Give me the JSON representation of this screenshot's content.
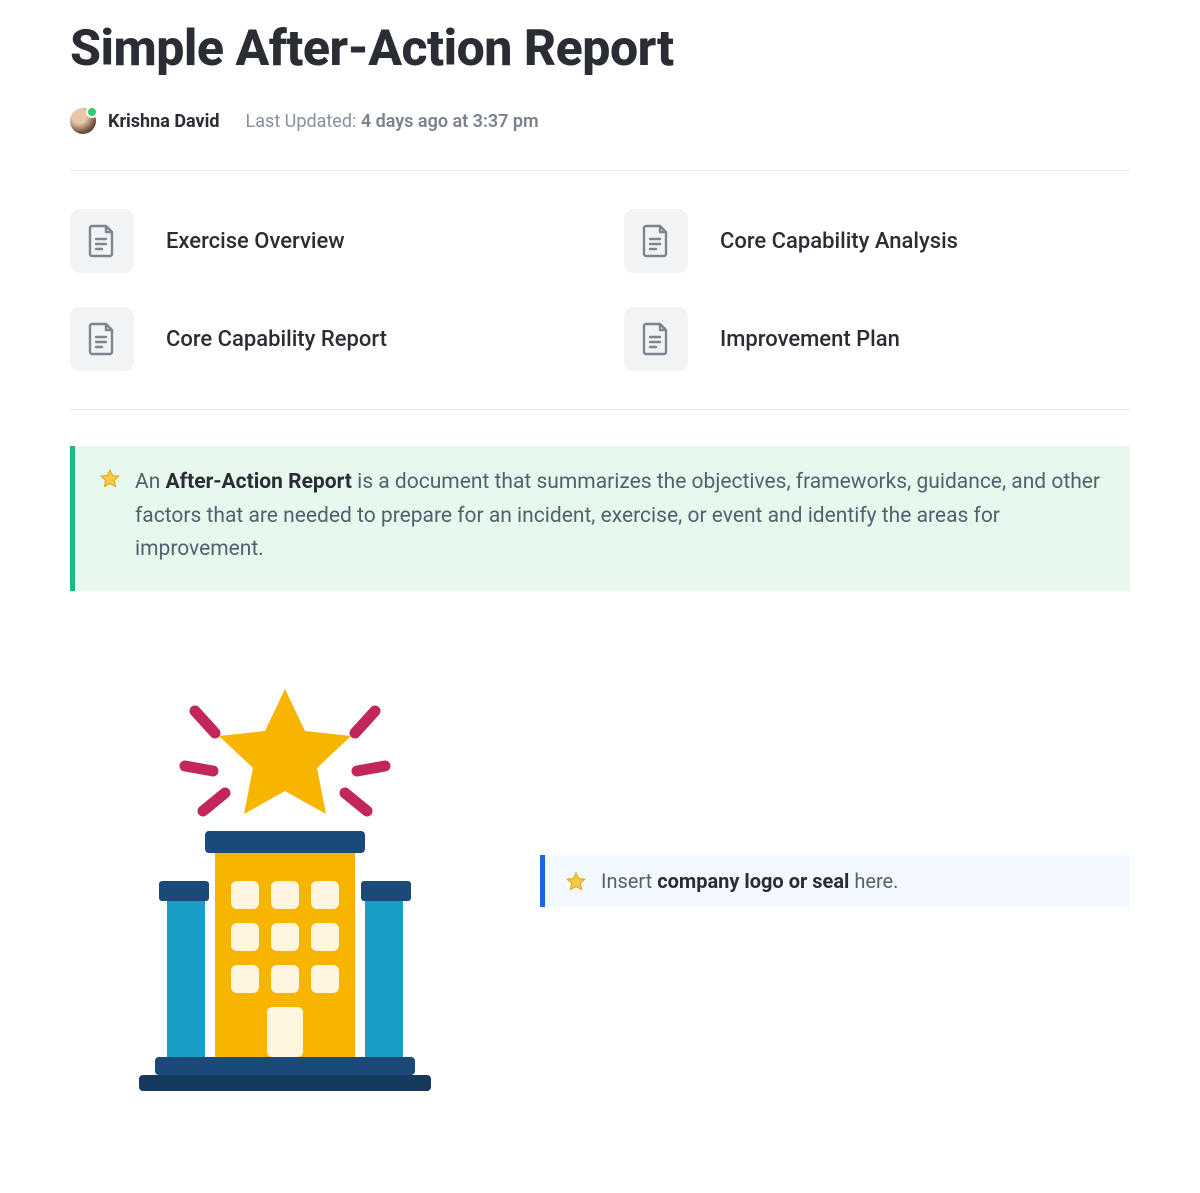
{
  "title": "Simple After-Action Report",
  "author": "Krishna David",
  "updated_label": "Last Updated: ",
  "updated_value": "4 days ago at 3:37 pm",
  "nav": [
    {
      "label": "Exercise Overview"
    },
    {
      "label": "Core Capability Analysis"
    },
    {
      "label": "Core Capability Report"
    },
    {
      "label": "Improvement Plan"
    }
  ],
  "definition": {
    "prefix": "An ",
    "term": "After-Action Report",
    "body": " is a document that summarizes the objectives, frameworks, guidance, and other factors that are needed to prepare for an incident, exercise, or event and identify the areas for improvement."
  },
  "logo_callout": {
    "prefix": "Insert ",
    "bold": "company logo or seal",
    "suffix": " here."
  },
  "icons": {
    "document": "document-icon",
    "star": "star-icon"
  },
  "colors": {
    "green_accent": "#1db884",
    "green_bg": "#e7f8ef",
    "blue_accent": "#1e62e8",
    "blue_bg": "#f3f9ff"
  }
}
